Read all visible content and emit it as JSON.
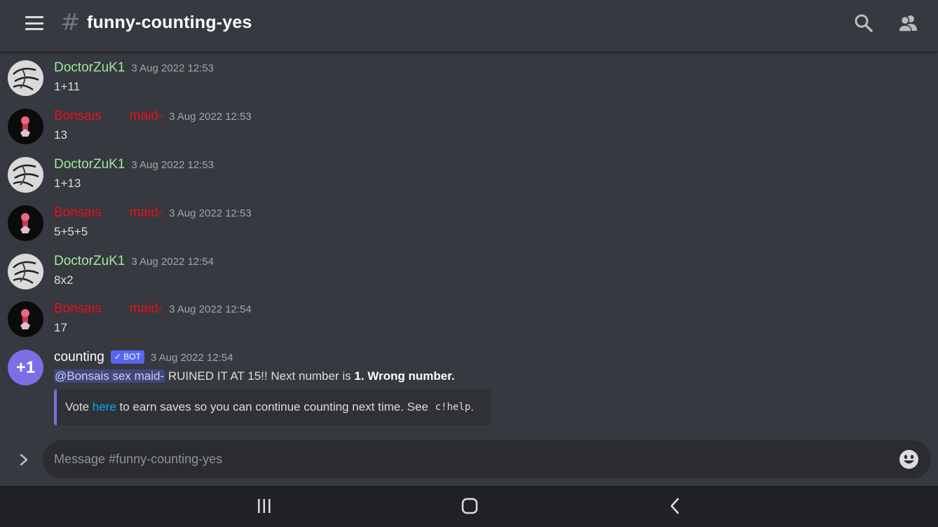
{
  "header": {
    "channel_name": "funny-counting-yes",
    "menu_icon": "hamburger-menu-icon",
    "hash_icon": "hash-icon",
    "search_icon": "search-icon",
    "members_icon": "members-icon"
  },
  "colors": {
    "background": "#36393f",
    "doctor_name": "#a3e7a0",
    "bonsai_name": "#e8101a",
    "bot_badge": "#5865f2",
    "link": "#00aff4",
    "embed_border": "#7d6fd8"
  },
  "messages": [
    {
      "author": "DoctorZuK1",
      "timestamp": "3 Aug 2022 12:53",
      "text": "1+11"
    },
    {
      "author_part1": "Bonsais",
      "author_part2": "maid-",
      "timestamp": "3 Aug 2022 12:53",
      "text": "13"
    },
    {
      "author": "DoctorZuK1",
      "timestamp": "3 Aug 2022 12:53",
      "text": "1+13"
    },
    {
      "author_part1": "Bonsais",
      "author_part2": "maid-",
      "timestamp": "3 Aug 2022 12:53",
      "text": "5+5+5"
    },
    {
      "author": "DoctorZuK1",
      "timestamp": "3 Aug 2022 12:54",
      "text": "8x2"
    },
    {
      "author_part1": "Bonsais",
      "author_part2": "maid-",
      "timestamp": "3 Aug 2022 12:54",
      "text": "17"
    }
  ],
  "bot_message": {
    "avatar_text": "+1",
    "author": "counting",
    "badge": "BOT",
    "badge_check": "✓",
    "timestamp": "3 Aug 2022 12:54",
    "mention": "@Bonsais sex maid-",
    "text_mid": " RUINED IT AT 15!! Next number is ",
    "text_bold": "1. Wrong number.",
    "embed": {
      "prefix": "Vote ",
      "link": "here",
      "middle": " to earn saves so you can continue counting next time. See ",
      "code": "c!help",
      "suffix": "."
    }
  },
  "composer": {
    "placeholder": "Message #funny-counting-yes",
    "expand_icon": "chevron-right-icon",
    "emoji_icon": "emoji-icon"
  },
  "system_nav": {
    "recents_icon": "recent-apps-icon",
    "home_icon": "home-icon",
    "back_icon": "back-icon"
  }
}
